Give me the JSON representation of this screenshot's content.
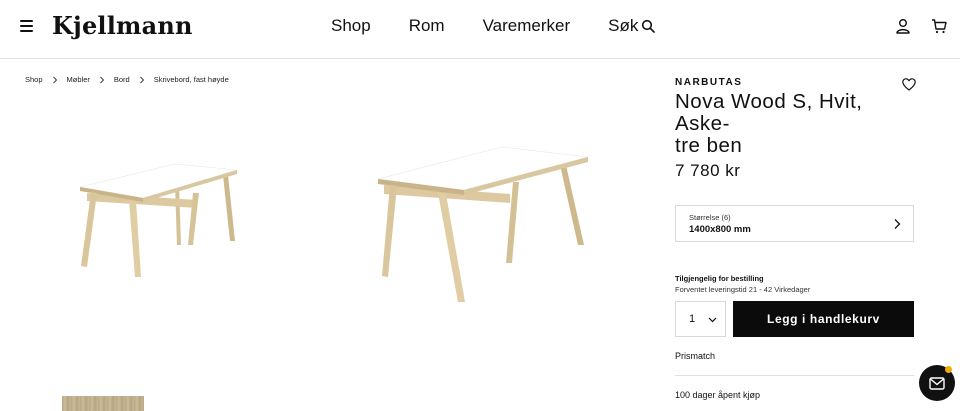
{
  "header": {
    "logo": "Kjellmann",
    "nav": [
      "Shop",
      "Rom",
      "Varemerker",
      "Søk"
    ],
    "icons": [
      "menu-icon",
      "search-icon",
      "user-icon",
      "cart-icon"
    ]
  },
  "breadcrumb": [
    "Shop",
    "Møbler",
    "Bord",
    "Skrivebord, fast høyde"
  ],
  "product": {
    "brand": "NARBUTAS",
    "title": "Nova Wood S, Hvit, Asketre ben",
    "title_line1": "Nova Wood S, Hvit, Aske-",
    "title_line2": "tre ben",
    "price": "7 780 kr",
    "size_label": "Størrelse (6)",
    "size_value": "1400x800 mm",
    "availability_title": "Tilgjengelig for bestilling",
    "availability_sub": "Forventet leveringstid 21 - 42 Virkedager",
    "quantity": "1",
    "add_to_cart": "Legg i handlekurv",
    "price_match": "Prismatch",
    "open_purchase": "100 dager åpent kjøp"
  },
  "colors": {
    "accent": "#0b0b0b",
    "table_top": "#ffffff",
    "table_wood": "#d8c49a",
    "chat_badge": "#f2a900"
  }
}
